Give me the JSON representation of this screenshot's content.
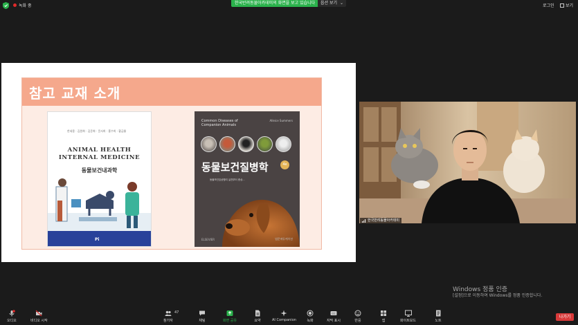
{
  "topbar": {
    "recording_label": "녹화 중",
    "share_banner": "한국반려동물아카데미의 화면을 보고 있습니다",
    "view_options_label": "옵션 보기",
    "legend_label": "로그인",
    "view_label": "보기"
  },
  "slide": {
    "title": "참고 교재 소개",
    "book1": {
      "authors": "한세용 · 김원화 · 김준화 · 윤서희 · 홍수희 · 황금룡",
      "title_en_line1": "ANIMAL HEALTH",
      "title_en_line2": "INTERNAL MEDICINE",
      "title_ko": "동물보건내과학",
      "publisher": "Pi"
    },
    "book2": {
      "title_en_line1": "Common Diseases of",
      "title_en_line2": "Companion Animals",
      "author": "Alleice Summers",
      "title_ko": "동물보건질병학",
      "edition": "4e",
      "subtitle": "동물보건임상병리 실전부터 증상...",
      "publisher_left": "ELSEVIER",
      "publisher_right": "범문에듀케이션"
    }
  },
  "video": {
    "participant_name": "한국반려동물아카데미"
  },
  "watermark": {
    "line1": "Windows 정품 인증",
    "line2": "[설정]으로 이동하여 Windows를 정품 인증합니다."
  },
  "toolbar": {
    "audio": "오디오",
    "video": "비디오 시작",
    "participants": "참가자",
    "participants_count": "47",
    "chat": "채팅",
    "share": "화면 공유",
    "summary": "요약",
    "ai": "AI Companion",
    "record": "녹화",
    "captions": "자막 표시",
    "reactions": "반응",
    "apps": "앱",
    "whiteboard": "화이트보드",
    "notes": "노트",
    "leave": "나가기"
  },
  "colors": {
    "share_green": "#2bb24c",
    "slide_title_bar": "#f5a88c",
    "leave_red": "#d93a3a"
  }
}
